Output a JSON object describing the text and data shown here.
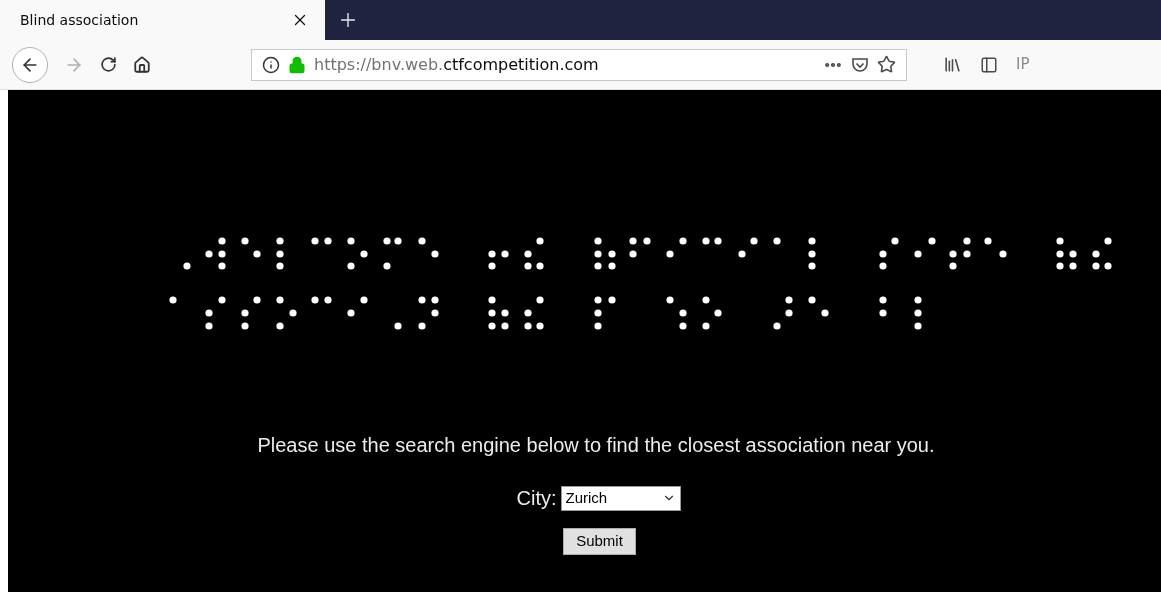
{
  "tabs": [
    {
      "title": "Blind association",
      "selected": true
    }
  ],
  "address_bar": {
    "url_prefix": "https://bnv.web.",
    "url_domain": "ctfcompetition.com"
  },
  "toolbar": {
    "extension_label": "IP"
  },
  "page": {
    "intro": "Please use the search engine below to find the closest association near you.",
    "city_label": "City:",
    "city_value": "Zurich",
    "submit_label": "Submit"
  }
}
